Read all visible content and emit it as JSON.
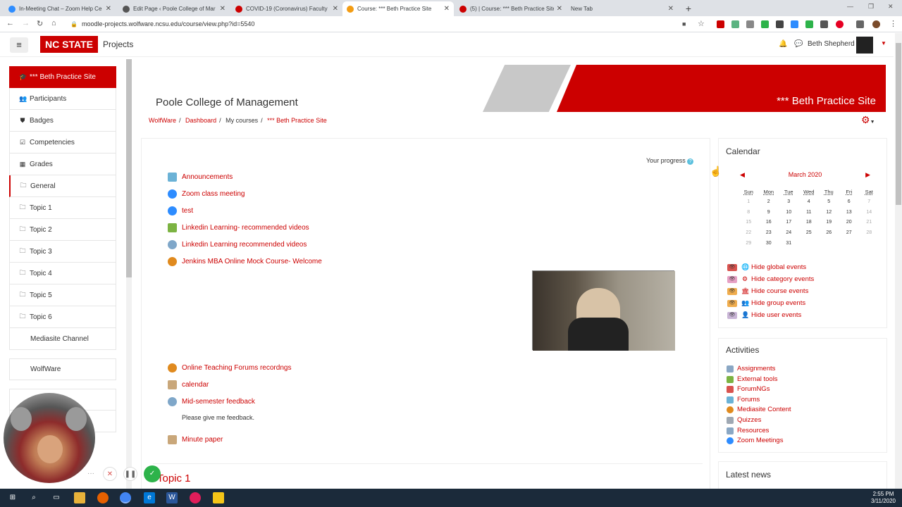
{
  "browser": {
    "tabs": [
      {
        "title": "In-Meeting Chat – Zoom Help Ce",
        "color": "#2d8cff"
      },
      {
        "title": "Edit Page ‹ Poole College of Mar",
        "color": "#555555"
      },
      {
        "title": "COVID-19 (Coronavirus) Faculty",
        "color": "#cc0000"
      },
      {
        "title": "Course: *** Beth Practice Site",
        "color": "#f39c12"
      },
      {
        "title": "(5) | Course: *** Beth Practice Site",
        "color": "#cc0000"
      },
      {
        "title": "New Tab",
        "color": ""
      }
    ],
    "url": "moodle-projects.wolfware.ncsu.edu/course/view.php?id=5540"
  },
  "header": {
    "logo": "NC STATE",
    "app_name": "Projects",
    "user_name": "Beth Shepherd"
  },
  "sidebar": {
    "items": [
      {
        "label": "*** Beth Practice Site",
        "icon": "graduation-cap-icon"
      },
      {
        "label": "Participants",
        "icon": "users-icon"
      },
      {
        "label": "Badges",
        "icon": "shield-icon"
      },
      {
        "label": "Competencies",
        "icon": "check-square-icon"
      },
      {
        "label": "Grades",
        "icon": "table-icon"
      },
      {
        "label": "General",
        "icon": "folder-icon"
      },
      {
        "label": "Topic 1",
        "icon": "folder-icon"
      },
      {
        "label": "Topic 2",
        "icon": "folder-icon"
      },
      {
        "label": "Topic 3",
        "icon": "folder-icon"
      },
      {
        "label": "Topic 4",
        "icon": "folder-icon"
      },
      {
        "label": "Topic 5",
        "icon": "folder-icon"
      },
      {
        "label": "Topic 6",
        "icon": "folder-icon"
      },
      {
        "label": "Mediasite Channel",
        "icon": ""
      }
    ],
    "wolfware": "WolfWare"
  },
  "banner": {
    "org": "Poole College of Management",
    "site": "*** Beth Practice Site"
  },
  "breadcrumb": [
    "WolfWare",
    "Dashboard",
    "My courses",
    "*** Beth Practice Site"
  ],
  "main": {
    "progress_label": "Your progress",
    "activities": [
      {
        "label": "Announcements",
        "icon": "forum-icon",
        "color": "#6bb2d6"
      },
      {
        "label": "Zoom class meeting",
        "icon": "zoom-icon",
        "color": "#2d8cff"
      },
      {
        "label": "test",
        "icon": "zoom-icon",
        "color": "#2d8cff"
      },
      {
        "label": "Linkedin Learning- recommended videos",
        "icon": "puzzle-icon",
        "color": "#7cb342"
      },
      {
        "label": "Linkedin Learning recommended videos",
        "icon": "url-icon",
        "color": "#7fa7c9"
      },
      {
        "label": "Jenkins MBA Online Mock Course- Welcome",
        "icon": "mediasite-icon",
        "color": "#e08a1e"
      },
      {
        "label": "Online Teaching Forums recordngs",
        "icon": "mediasite-icon",
        "color": "#e08a1e"
      },
      {
        "label": "calendar",
        "icon": "page-icon",
        "color": "#c9a77a"
      },
      {
        "label": "Mid-semester feedback",
        "icon": "url-icon",
        "color": "#7fa7c9"
      },
      {
        "label": "Minute paper",
        "icon": "page-icon",
        "color": "#c9a77a"
      }
    ],
    "feedback_desc": "Please give me feedback.",
    "next_section": "Topic 1"
  },
  "calendar": {
    "title": "Calendar",
    "month": "March 2020",
    "days": [
      "Sun",
      "Mon",
      "Tue",
      "Wed",
      "Thu",
      "Fri",
      "Sat"
    ],
    "weeks": [
      [
        "1",
        "2",
        "3",
        "4",
        "5",
        "6",
        "7"
      ],
      [
        "8",
        "9",
        "10",
        "11",
        "12",
        "13",
        "14"
      ],
      [
        "15",
        "16",
        "17",
        "18",
        "19",
        "20",
        "21"
      ],
      [
        "22",
        "23",
        "24",
        "25",
        "26",
        "27",
        "28"
      ],
      [
        "29",
        "30",
        "31",
        "",
        "",
        "",
        ""
      ]
    ],
    "events": [
      {
        "label": "Hide global events",
        "color": "#d9534f"
      },
      {
        "label": "Hide category events",
        "color": "#e6a0c4"
      },
      {
        "label": "Hide course events",
        "color": "#f0ad4e"
      },
      {
        "label": "Hide group events",
        "color": "#f0ad4e"
      },
      {
        "label": "Hide user events",
        "color": "#c9b5d6"
      }
    ]
  },
  "activities_block": {
    "title": "Activities",
    "items": [
      {
        "label": "Assignments",
        "color": "#8aa7c4"
      },
      {
        "label": "External tools",
        "color": "#7cb342"
      },
      {
        "label": "ForumNGs",
        "color": "#d9534f"
      },
      {
        "label": "Forums",
        "color": "#6bb2d6"
      },
      {
        "label": "Mediasite Content",
        "color": "#e08a1e"
      },
      {
        "label": "Quizzes",
        "color": "#9fa8b3"
      },
      {
        "label": "Resources",
        "color": "#8aa7c4"
      },
      {
        "label": "Zoom Meetings",
        "color": "#2d8cff"
      }
    ]
  },
  "latest_news": {
    "title": "Latest news"
  },
  "taskbar": {
    "time": "2:55 PM",
    "date": "3/11/2020"
  }
}
